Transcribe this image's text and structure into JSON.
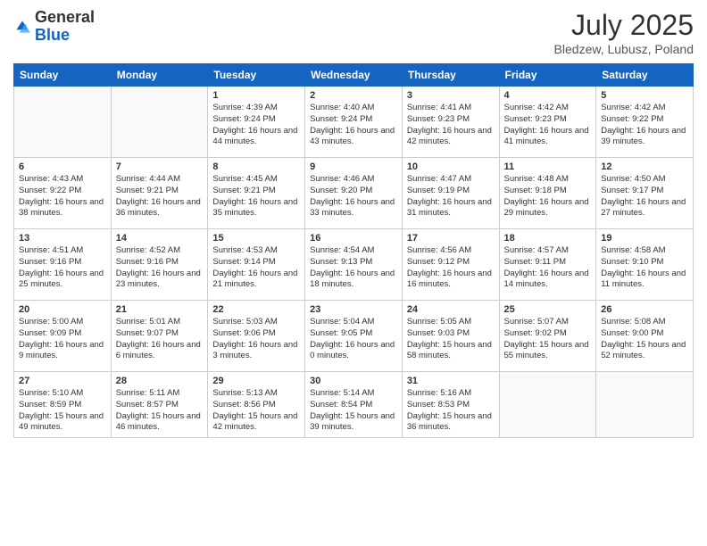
{
  "header": {
    "logo_general": "General",
    "logo_blue": "Blue",
    "title": "July 2025",
    "location": "Bledzew, Lubusz, Poland"
  },
  "days_of_week": [
    "Sunday",
    "Monday",
    "Tuesday",
    "Wednesday",
    "Thursday",
    "Friday",
    "Saturday"
  ],
  "weeks": [
    [
      {
        "day": "",
        "info": ""
      },
      {
        "day": "",
        "info": ""
      },
      {
        "day": "1",
        "info": "Sunrise: 4:39 AM\nSunset: 9:24 PM\nDaylight: 16 hours and 44 minutes."
      },
      {
        "day": "2",
        "info": "Sunrise: 4:40 AM\nSunset: 9:24 PM\nDaylight: 16 hours and 43 minutes."
      },
      {
        "day": "3",
        "info": "Sunrise: 4:41 AM\nSunset: 9:23 PM\nDaylight: 16 hours and 42 minutes."
      },
      {
        "day": "4",
        "info": "Sunrise: 4:42 AM\nSunset: 9:23 PM\nDaylight: 16 hours and 41 minutes."
      },
      {
        "day": "5",
        "info": "Sunrise: 4:42 AM\nSunset: 9:22 PM\nDaylight: 16 hours and 39 minutes."
      }
    ],
    [
      {
        "day": "6",
        "info": "Sunrise: 4:43 AM\nSunset: 9:22 PM\nDaylight: 16 hours and 38 minutes."
      },
      {
        "day": "7",
        "info": "Sunrise: 4:44 AM\nSunset: 9:21 PM\nDaylight: 16 hours and 36 minutes."
      },
      {
        "day": "8",
        "info": "Sunrise: 4:45 AM\nSunset: 9:21 PM\nDaylight: 16 hours and 35 minutes."
      },
      {
        "day": "9",
        "info": "Sunrise: 4:46 AM\nSunset: 9:20 PM\nDaylight: 16 hours and 33 minutes."
      },
      {
        "day": "10",
        "info": "Sunrise: 4:47 AM\nSunset: 9:19 PM\nDaylight: 16 hours and 31 minutes."
      },
      {
        "day": "11",
        "info": "Sunrise: 4:48 AM\nSunset: 9:18 PM\nDaylight: 16 hours and 29 minutes."
      },
      {
        "day": "12",
        "info": "Sunrise: 4:50 AM\nSunset: 9:17 PM\nDaylight: 16 hours and 27 minutes."
      }
    ],
    [
      {
        "day": "13",
        "info": "Sunrise: 4:51 AM\nSunset: 9:16 PM\nDaylight: 16 hours and 25 minutes."
      },
      {
        "day": "14",
        "info": "Sunrise: 4:52 AM\nSunset: 9:16 PM\nDaylight: 16 hours and 23 minutes."
      },
      {
        "day": "15",
        "info": "Sunrise: 4:53 AM\nSunset: 9:14 PM\nDaylight: 16 hours and 21 minutes."
      },
      {
        "day": "16",
        "info": "Sunrise: 4:54 AM\nSunset: 9:13 PM\nDaylight: 16 hours and 18 minutes."
      },
      {
        "day": "17",
        "info": "Sunrise: 4:56 AM\nSunset: 9:12 PM\nDaylight: 16 hours and 16 minutes."
      },
      {
        "day": "18",
        "info": "Sunrise: 4:57 AM\nSunset: 9:11 PM\nDaylight: 16 hours and 14 minutes."
      },
      {
        "day": "19",
        "info": "Sunrise: 4:58 AM\nSunset: 9:10 PM\nDaylight: 16 hours and 11 minutes."
      }
    ],
    [
      {
        "day": "20",
        "info": "Sunrise: 5:00 AM\nSunset: 9:09 PM\nDaylight: 16 hours and 9 minutes."
      },
      {
        "day": "21",
        "info": "Sunrise: 5:01 AM\nSunset: 9:07 PM\nDaylight: 16 hours and 6 minutes."
      },
      {
        "day": "22",
        "info": "Sunrise: 5:03 AM\nSunset: 9:06 PM\nDaylight: 16 hours and 3 minutes."
      },
      {
        "day": "23",
        "info": "Sunrise: 5:04 AM\nSunset: 9:05 PM\nDaylight: 16 hours and 0 minutes."
      },
      {
        "day": "24",
        "info": "Sunrise: 5:05 AM\nSunset: 9:03 PM\nDaylight: 15 hours and 58 minutes."
      },
      {
        "day": "25",
        "info": "Sunrise: 5:07 AM\nSunset: 9:02 PM\nDaylight: 15 hours and 55 minutes."
      },
      {
        "day": "26",
        "info": "Sunrise: 5:08 AM\nSunset: 9:00 PM\nDaylight: 15 hours and 52 minutes."
      }
    ],
    [
      {
        "day": "27",
        "info": "Sunrise: 5:10 AM\nSunset: 8:59 PM\nDaylight: 15 hours and 49 minutes."
      },
      {
        "day": "28",
        "info": "Sunrise: 5:11 AM\nSunset: 8:57 PM\nDaylight: 15 hours and 46 minutes."
      },
      {
        "day": "29",
        "info": "Sunrise: 5:13 AM\nSunset: 8:56 PM\nDaylight: 15 hours and 42 minutes."
      },
      {
        "day": "30",
        "info": "Sunrise: 5:14 AM\nSunset: 8:54 PM\nDaylight: 15 hours and 39 minutes."
      },
      {
        "day": "31",
        "info": "Sunrise: 5:16 AM\nSunset: 8:53 PM\nDaylight: 15 hours and 36 minutes."
      },
      {
        "day": "",
        "info": ""
      },
      {
        "day": "",
        "info": ""
      }
    ]
  ]
}
